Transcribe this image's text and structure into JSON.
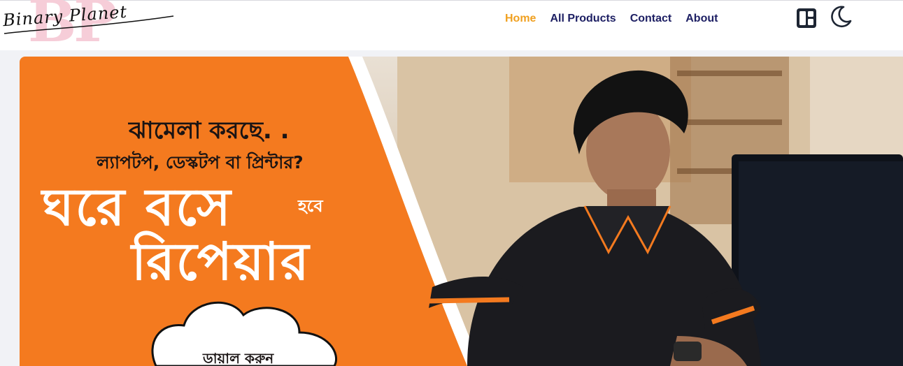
{
  "navbar": {
    "logo_monogram": "BP",
    "logo_text": "Binary Planet",
    "links": [
      {
        "label": "Home",
        "active": true
      },
      {
        "label": "All Products",
        "active": false
      },
      {
        "label": "Contact",
        "active": false
      },
      {
        "label": "About",
        "active": false
      }
    ],
    "icons": [
      "dashboard-layout-icon",
      "moon-icon"
    ]
  },
  "banner": {
    "line1": "ঝামেলা করছে. .",
    "line2": "ল্যাপটপ, ডেস্কটপ বা প্রিন্টার?",
    "line3": "ঘরে বসে",
    "line3_small": "হবে",
    "line4": "রিপেয়ার",
    "call_label": "ডায়াল করুন"
  },
  "colors": {
    "accent_orange": "#f47a1f",
    "nav_text": "#1e2064",
    "nav_active": "#f0a020"
  }
}
